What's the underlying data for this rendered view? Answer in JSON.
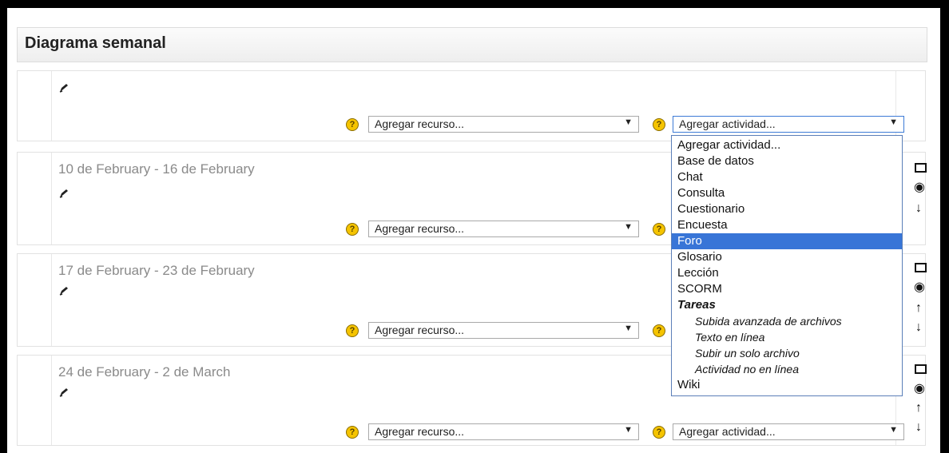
{
  "header": {
    "title": "Diagrama semanal"
  },
  "sections": [
    {
      "title": ""
    },
    {
      "title": "10 de February - 16 de February"
    },
    {
      "title": "17 de February - 23 de February"
    },
    {
      "title": "24 de February - 2 de March"
    }
  ],
  "controls": {
    "help_glyph": "?",
    "resource_select": "Agregar recurso...",
    "activity_select": "Agregar actividad...",
    "arrow_glyph": "▼"
  },
  "dropdown": {
    "options": [
      "Agregar actividad...",
      "Base de datos",
      "Chat",
      "Consulta",
      "Cuestionario",
      "Encuesta",
      "Foro",
      "Glosario",
      "Lección",
      "SCORM",
      "Tareas",
      "Subida avanzada de archivos",
      "Texto en línea",
      "Subir un solo archivo",
      "Actividad no en línea",
      "Wiki"
    ],
    "selected": "Foro"
  },
  "icons": {
    "edit": "pencil-edit-icon",
    "highlight": "square-icon",
    "visibility": "eye-icon",
    "move_up": "arrow-up-icon",
    "move_down": "arrow-down-icon"
  }
}
